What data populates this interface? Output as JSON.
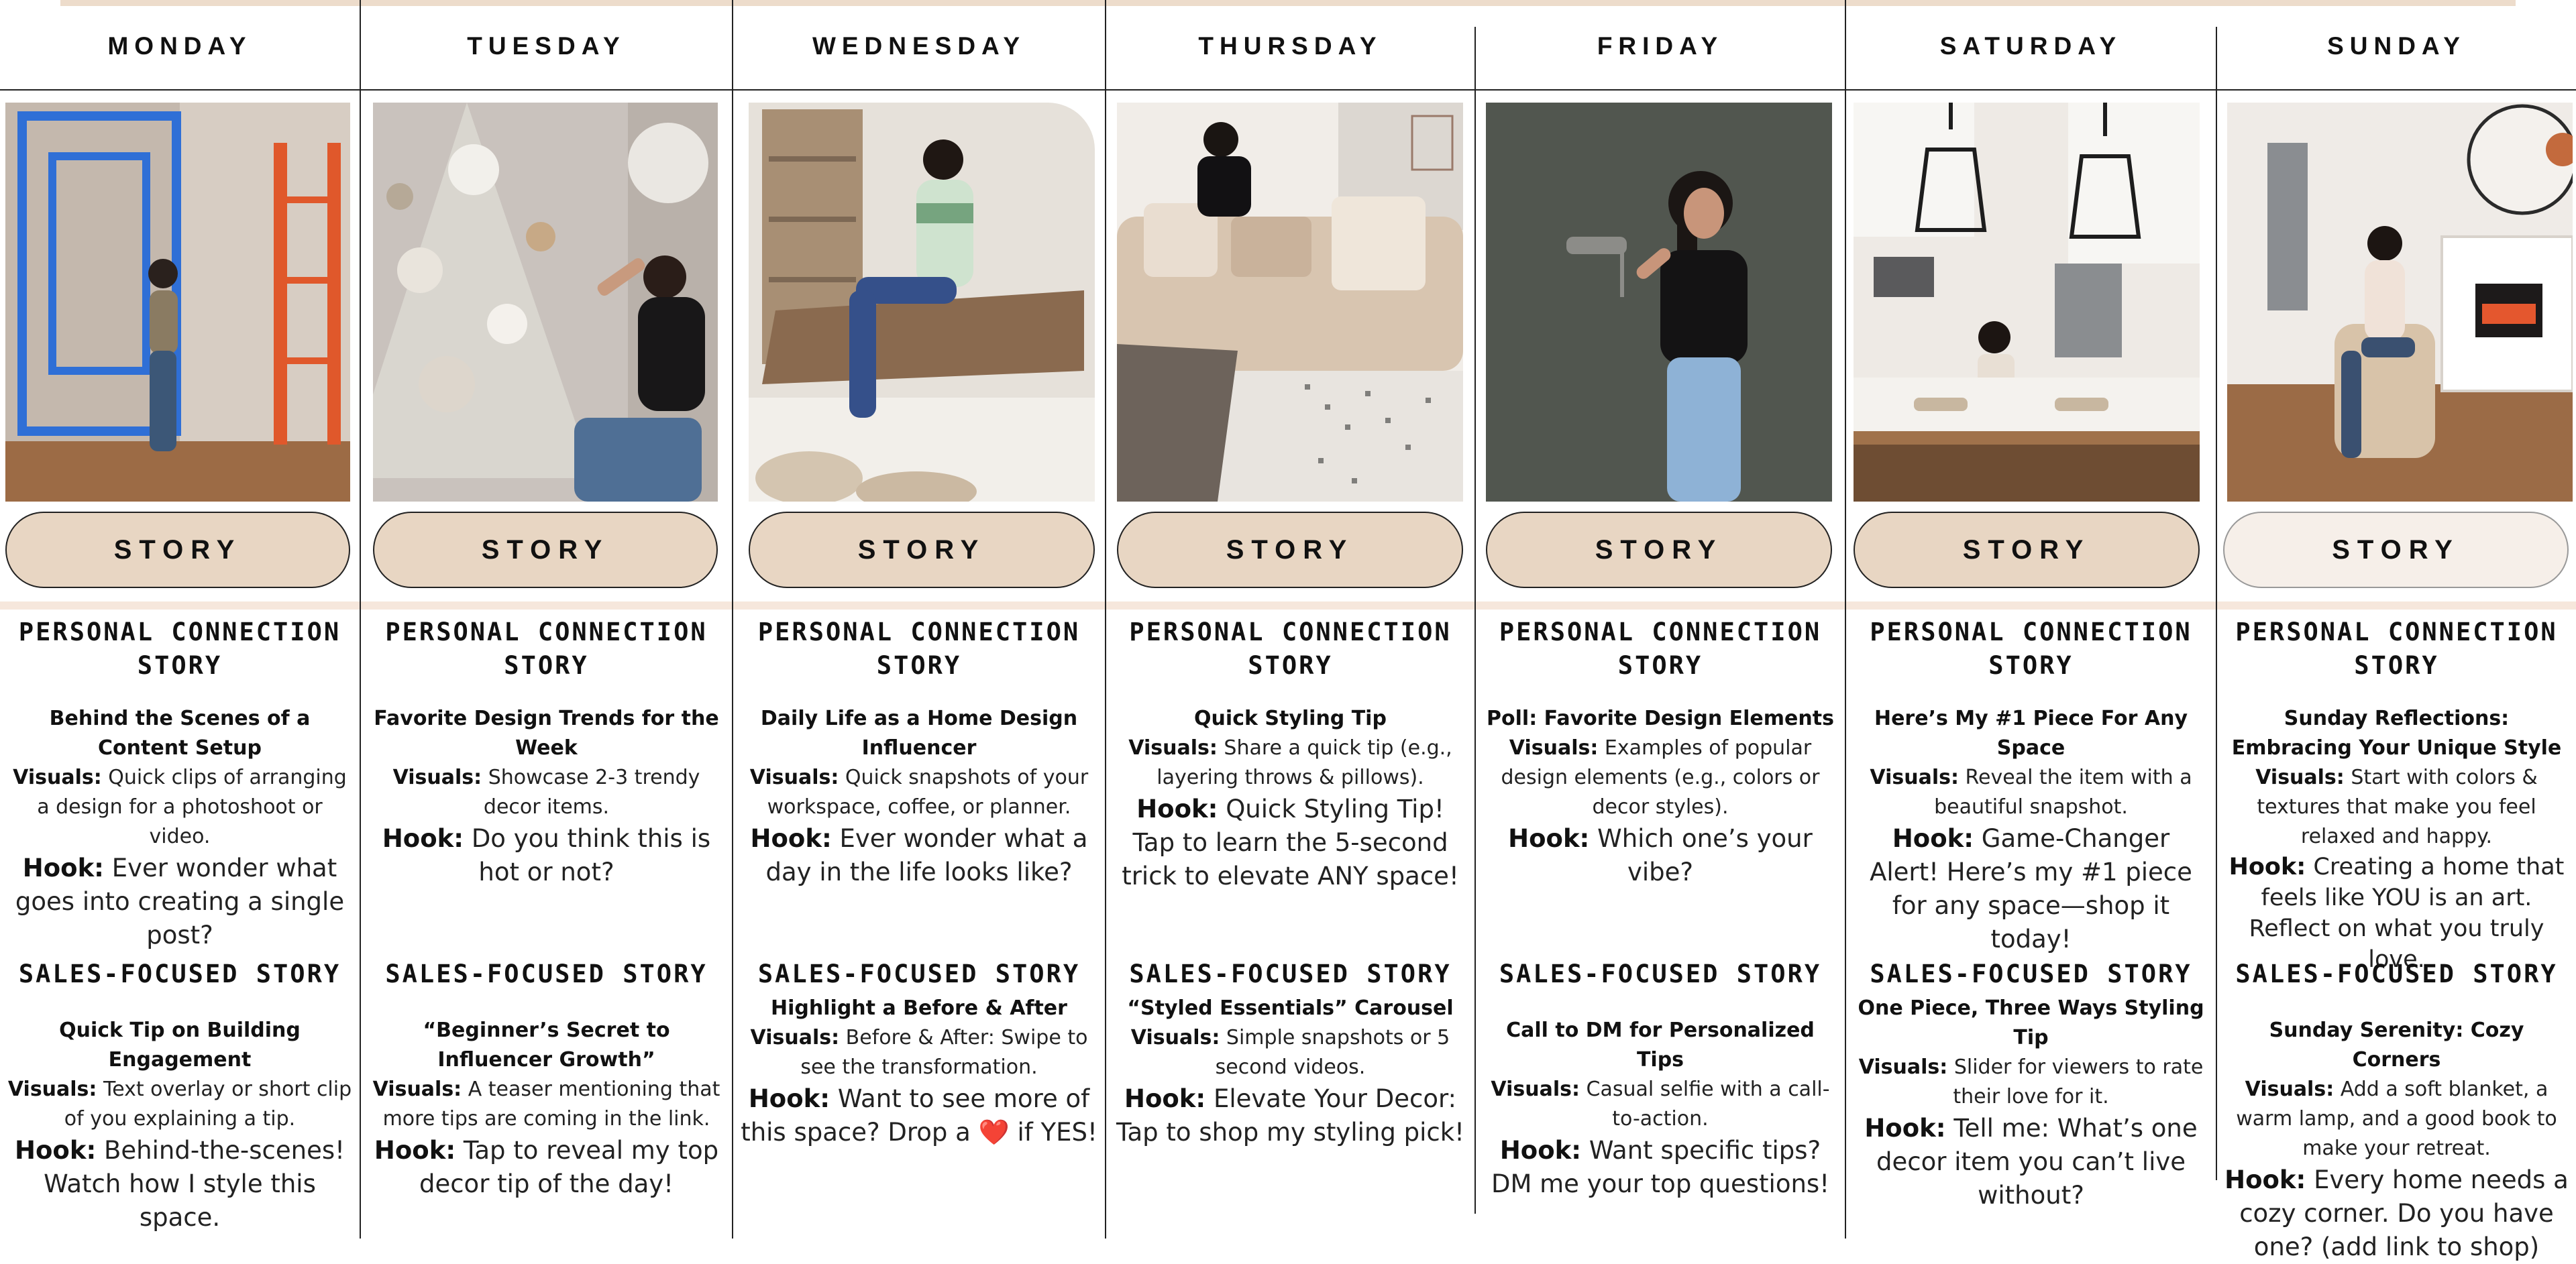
{
  "days": [
    {
      "name": "MONDAY",
      "button": "STORY",
      "personal": {
        "category": "PERSONAL CONNECTION STORY",
        "title": "Behind the Scenes of a Content Setup",
        "visuals_label": "Visuals:",
        "visuals": "Quick clips of arranging a design for a photoshoot or video.",
        "hook_label": "Hook:",
        "hook": "Ever wonder what goes into creating a single post?"
      },
      "sales": {
        "category": "SALES-FOCUSED STORY",
        "title": "Quick Tip on Building Engagement",
        "visuals_label": "Visuals:",
        "visuals": "Text overlay or short clip of you explaining a tip.",
        "hook_label": "Hook:",
        "hook": "Behind-the-scenes! Watch how I style this space."
      }
    },
    {
      "name": "TUESDAY",
      "button": "STORY",
      "personal": {
        "category": "PERSONAL CONNECTION STORY",
        "title": "Favorite Design Trends for the Week",
        "visuals_label": "Visuals:",
        "visuals": "Showcase 2-3 trendy decor items.",
        "hook_label": "Hook:",
        "hook": "Do you think this is hot or not?"
      },
      "sales": {
        "category": "SALES-FOCUSED STORY",
        "title": "“Beginner’s Secret to Influencer Growth”",
        "visuals_label": "Visuals:",
        "visuals": "A teaser mentioning that more tips are coming in the link.",
        "hook_label": "Hook:",
        "hook": "Tap to reveal my top decor tip of the day!"
      }
    },
    {
      "name": "WEDNESDAY",
      "button": "STORY",
      "personal": {
        "category": "PERSONAL CONNECTION STORY",
        "title": "Daily Life as a Home Design Influencer",
        "visuals_label": "Visuals:",
        "visuals": "Quick snapshots of your workspace, coffee, or planner.",
        "hook_label": "Hook:",
        "hook": "Ever wonder what a day in the life looks like?"
      },
      "sales": {
        "category": "SALES-FOCUSED STORY",
        "title": "Highlight a Before & After",
        "visuals_label": "Visuals:",
        "visuals": "Before & After: Swipe to see the transformation.",
        "hook_label": "Hook:",
        "hook": "Want to see more of this space? Drop a ❤️ if YES!"
      }
    },
    {
      "name": "THURSDAY",
      "button": "STORY",
      "personal": {
        "category": "PERSONAL CONNECTION STORY",
        "title": "Quick Styling Tip",
        "visuals_label": "Visuals:",
        "visuals": "Share a quick tip (e.g., layering throws & pillows).",
        "hook_label": "Hook:",
        "hook": "Quick Styling Tip! Tap to learn the 5-second trick to elevate ANY space!"
      },
      "sales": {
        "category": "SALES-FOCUSED STORY",
        "title": "“Styled Essentials” Carousel",
        "visuals_label": "Visuals:",
        "visuals": "Simple snapshots or 5 second videos.",
        "hook_label": "Hook:",
        "hook": "Elevate Your Decor: Tap to shop my styling pick!"
      }
    },
    {
      "name": "FRIDAY",
      "button": "STORY",
      "personal": {
        "category": "PERSONAL CONNECTION STORY",
        "title": "Poll: Favorite Design Elements",
        "visuals_label": "Visuals:",
        "visuals": "Examples of popular design elements (e.g., colors or decor styles).",
        "hook_label": "Hook:",
        "hook": "Which one’s your vibe?"
      },
      "sales": {
        "category": "SALES-FOCUSED STORY",
        "title": "Call to DM for Personalized Tips",
        "visuals_label": "Visuals:",
        "visuals": "Casual selfie with a call-to-action.",
        "hook_label": "Hook:",
        "hook": "Want specific tips? DM me your top questions!"
      }
    },
    {
      "name": "SATURDAY",
      "button": "STORY",
      "personal": {
        "category": "PERSONAL CONNECTION STORY",
        "title": "Here’s My #1 Piece For Any Space",
        "visuals_label": "Visuals:",
        "visuals": "Reveal the item with a beautiful snapshot.",
        "hook_label": "Hook:",
        "hook": "Game-Changer Alert! Here’s my #1 piece for any space—shop it today!"
      },
      "sales": {
        "category": "SALES-FOCUSED STORY",
        "title": "One Piece, Three Ways Styling Tip",
        "visuals_label": "Visuals:",
        "visuals": "Slider for viewers to rate their love for it.",
        "hook_label": "Hook:",
        "hook": "Tell me: What’s one decor item you can’t live without?"
      }
    },
    {
      "name": "SUNDAY",
      "button": "STORY",
      "personal": {
        "category": "PERSONAL CONNECTION STORY",
        "title": "Sunday Reflections: Embracing Your Unique Style",
        "visuals_label": "Visuals:",
        "visuals": "Start with colors & textures that make you feel relaxed and happy.",
        "hook_label": "Hook:",
        "hook": "Creating a home that feels like YOU is an art. Reflect on what you truly love."
      },
      "sales": {
        "category": "SALES-FOCUSED STORY",
        "title": "Sunday Serenity: Cozy Corners",
        "visuals_label": "Visuals:",
        "visuals": "Add a soft blanket, a warm lamp, and a good book to make your retreat.",
        "hook_label": "Hook:",
        "hook": "Every home needs a cozy corner. Do you have one? (add link to shop)"
      }
    }
  ],
  "colors": {
    "top_accent": "#eddccb",
    "button_fill": "#e8d6c3",
    "button_fill_sunday": "#f6efe9",
    "divider_band": "#f6e7dc",
    "rule": "#222222"
  },
  "photos": [
    "woman-with-painters-tape-wall",
    "woman-decorating-christmas-tree",
    "woman-sitting-on-coffee-table",
    "woman-styling-sofa-pillows",
    "woman-holding-paint-roller",
    "kitchen-with-pendant-lights",
    "woman-sitting-by-fireplace"
  ]
}
